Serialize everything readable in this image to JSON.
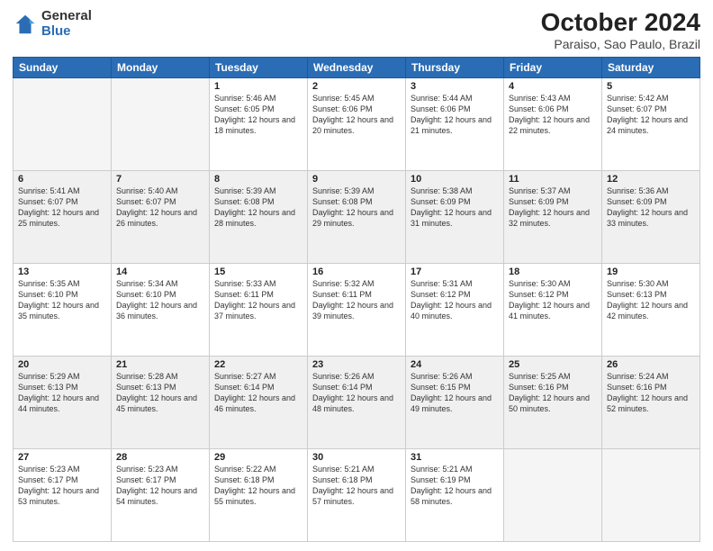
{
  "header": {
    "logo_general": "General",
    "logo_blue": "Blue",
    "title": "October 2024",
    "location": "Paraiso, Sao Paulo, Brazil"
  },
  "days_of_week": [
    "Sunday",
    "Monday",
    "Tuesday",
    "Wednesday",
    "Thursday",
    "Friday",
    "Saturday"
  ],
  "weeks": [
    [
      {
        "day": "",
        "sunrise": "",
        "sunset": "",
        "daylight": "",
        "empty": true
      },
      {
        "day": "",
        "sunrise": "",
        "sunset": "",
        "daylight": "",
        "empty": true
      },
      {
        "day": "1",
        "sunrise": "Sunrise: 5:46 AM",
        "sunset": "Sunset: 6:05 PM",
        "daylight": "Daylight: 12 hours and 18 minutes."
      },
      {
        "day": "2",
        "sunrise": "Sunrise: 5:45 AM",
        "sunset": "Sunset: 6:06 PM",
        "daylight": "Daylight: 12 hours and 20 minutes."
      },
      {
        "day": "3",
        "sunrise": "Sunrise: 5:44 AM",
        "sunset": "Sunset: 6:06 PM",
        "daylight": "Daylight: 12 hours and 21 minutes."
      },
      {
        "day": "4",
        "sunrise": "Sunrise: 5:43 AM",
        "sunset": "Sunset: 6:06 PM",
        "daylight": "Daylight: 12 hours and 22 minutes."
      },
      {
        "day": "5",
        "sunrise": "Sunrise: 5:42 AM",
        "sunset": "Sunset: 6:07 PM",
        "daylight": "Daylight: 12 hours and 24 minutes."
      }
    ],
    [
      {
        "day": "6",
        "sunrise": "Sunrise: 5:41 AM",
        "sunset": "Sunset: 6:07 PM",
        "daylight": "Daylight: 12 hours and 25 minutes."
      },
      {
        "day": "7",
        "sunrise": "Sunrise: 5:40 AM",
        "sunset": "Sunset: 6:07 PM",
        "daylight": "Daylight: 12 hours and 26 minutes."
      },
      {
        "day": "8",
        "sunrise": "Sunrise: 5:39 AM",
        "sunset": "Sunset: 6:08 PM",
        "daylight": "Daylight: 12 hours and 28 minutes."
      },
      {
        "day": "9",
        "sunrise": "Sunrise: 5:39 AM",
        "sunset": "Sunset: 6:08 PM",
        "daylight": "Daylight: 12 hours and 29 minutes."
      },
      {
        "day": "10",
        "sunrise": "Sunrise: 5:38 AM",
        "sunset": "Sunset: 6:09 PM",
        "daylight": "Daylight: 12 hours and 31 minutes."
      },
      {
        "day": "11",
        "sunrise": "Sunrise: 5:37 AM",
        "sunset": "Sunset: 6:09 PM",
        "daylight": "Daylight: 12 hours and 32 minutes."
      },
      {
        "day": "12",
        "sunrise": "Sunrise: 5:36 AM",
        "sunset": "Sunset: 6:09 PM",
        "daylight": "Daylight: 12 hours and 33 minutes."
      }
    ],
    [
      {
        "day": "13",
        "sunrise": "Sunrise: 5:35 AM",
        "sunset": "Sunset: 6:10 PM",
        "daylight": "Daylight: 12 hours and 35 minutes."
      },
      {
        "day": "14",
        "sunrise": "Sunrise: 5:34 AM",
        "sunset": "Sunset: 6:10 PM",
        "daylight": "Daylight: 12 hours and 36 minutes."
      },
      {
        "day": "15",
        "sunrise": "Sunrise: 5:33 AM",
        "sunset": "Sunset: 6:11 PM",
        "daylight": "Daylight: 12 hours and 37 minutes."
      },
      {
        "day": "16",
        "sunrise": "Sunrise: 5:32 AM",
        "sunset": "Sunset: 6:11 PM",
        "daylight": "Daylight: 12 hours and 39 minutes."
      },
      {
        "day": "17",
        "sunrise": "Sunrise: 5:31 AM",
        "sunset": "Sunset: 6:12 PM",
        "daylight": "Daylight: 12 hours and 40 minutes."
      },
      {
        "day": "18",
        "sunrise": "Sunrise: 5:30 AM",
        "sunset": "Sunset: 6:12 PM",
        "daylight": "Daylight: 12 hours and 41 minutes."
      },
      {
        "day": "19",
        "sunrise": "Sunrise: 5:30 AM",
        "sunset": "Sunset: 6:13 PM",
        "daylight": "Daylight: 12 hours and 42 minutes."
      }
    ],
    [
      {
        "day": "20",
        "sunrise": "Sunrise: 5:29 AM",
        "sunset": "Sunset: 6:13 PM",
        "daylight": "Daylight: 12 hours and 44 minutes."
      },
      {
        "day": "21",
        "sunrise": "Sunrise: 5:28 AM",
        "sunset": "Sunset: 6:13 PM",
        "daylight": "Daylight: 12 hours and 45 minutes."
      },
      {
        "day": "22",
        "sunrise": "Sunrise: 5:27 AM",
        "sunset": "Sunset: 6:14 PM",
        "daylight": "Daylight: 12 hours and 46 minutes."
      },
      {
        "day": "23",
        "sunrise": "Sunrise: 5:26 AM",
        "sunset": "Sunset: 6:14 PM",
        "daylight": "Daylight: 12 hours and 48 minutes."
      },
      {
        "day": "24",
        "sunrise": "Sunrise: 5:26 AM",
        "sunset": "Sunset: 6:15 PM",
        "daylight": "Daylight: 12 hours and 49 minutes."
      },
      {
        "day": "25",
        "sunrise": "Sunrise: 5:25 AM",
        "sunset": "Sunset: 6:16 PM",
        "daylight": "Daylight: 12 hours and 50 minutes."
      },
      {
        "day": "26",
        "sunrise": "Sunrise: 5:24 AM",
        "sunset": "Sunset: 6:16 PM",
        "daylight": "Daylight: 12 hours and 52 minutes."
      }
    ],
    [
      {
        "day": "27",
        "sunrise": "Sunrise: 5:23 AM",
        "sunset": "Sunset: 6:17 PM",
        "daylight": "Daylight: 12 hours and 53 minutes."
      },
      {
        "day": "28",
        "sunrise": "Sunrise: 5:23 AM",
        "sunset": "Sunset: 6:17 PM",
        "daylight": "Daylight: 12 hours and 54 minutes."
      },
      {
        "day": "29",
        "sunrise": "Sunrise: 5:22 AM",
        "sunset": "Sunset: 6:18 PM",
        "daylight": "Daylight: 12 hours and 55 minutes."
      },
      {
        "day": "30",
        "sunrise": "Sunrise: 5:21 AM",
        "sunset": "Sunset: 6:18 PM",
        "daylight": "Daylight: 12 hours and 57 minutes."
      },
      {
        "day": "31",
        "sunrise": "Sunrise: 5:21 AM",
        "sunset": "Sunset: 6:19 PM",
        "daylight": "Daylight: 12 hours and 58 minutes."
      },
      {
        "day": "",
        "sunrise": "",
        "sunset": "",
        "daylight": "",
        "empty": true
      },
      {
        "day": "",
        "sunrise": "",
        "sunset": "",
        "daylight": "",
        "empty": true
      }
    ]
  ]
}
